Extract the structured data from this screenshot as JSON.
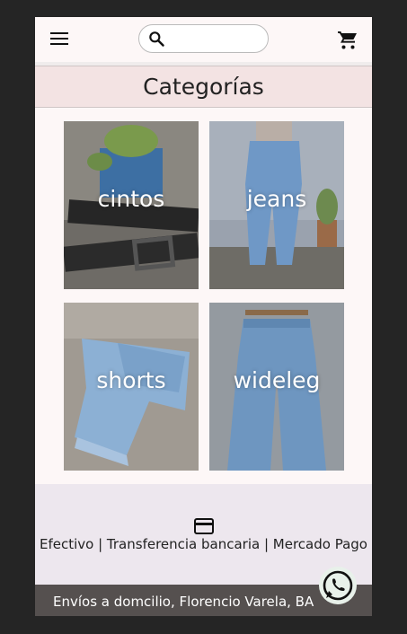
{
  "header": {
    "menu_icon": "hamburger-menu-icon",
    "search": {
      "icon": "search-icon",
      "value": "",
      "placeholder": ""
    },
    "cart_icon": "shopping-cart-icon"
  },
  "page_title": "Categorías",
  "categories": [
    {
      "label": "cintos"
    },
    {
      "label": "jeans"
    },
    {
      "label": "shorts"
    },
    {
      "label": "wideleg"
    }
  ],
  "payment": {
    "icon": "credit-card-icon",
    "text": "Efectivo | Transferencia bancaria | Mercado Pago"
  },
  "footer": {
    "shipping": "Envíos a domcilio, Florencio Varela, BA",
    "whatsapp_icon": "whatsapp-icon"
  },
  "colors": {
    "background": "#252525",
    "page": "#fdf7f7",
    "header_band": "#f3e3e3",
    "payment_band": "#ede7ee",
    "footer_band": "#55504f"
  }
}
